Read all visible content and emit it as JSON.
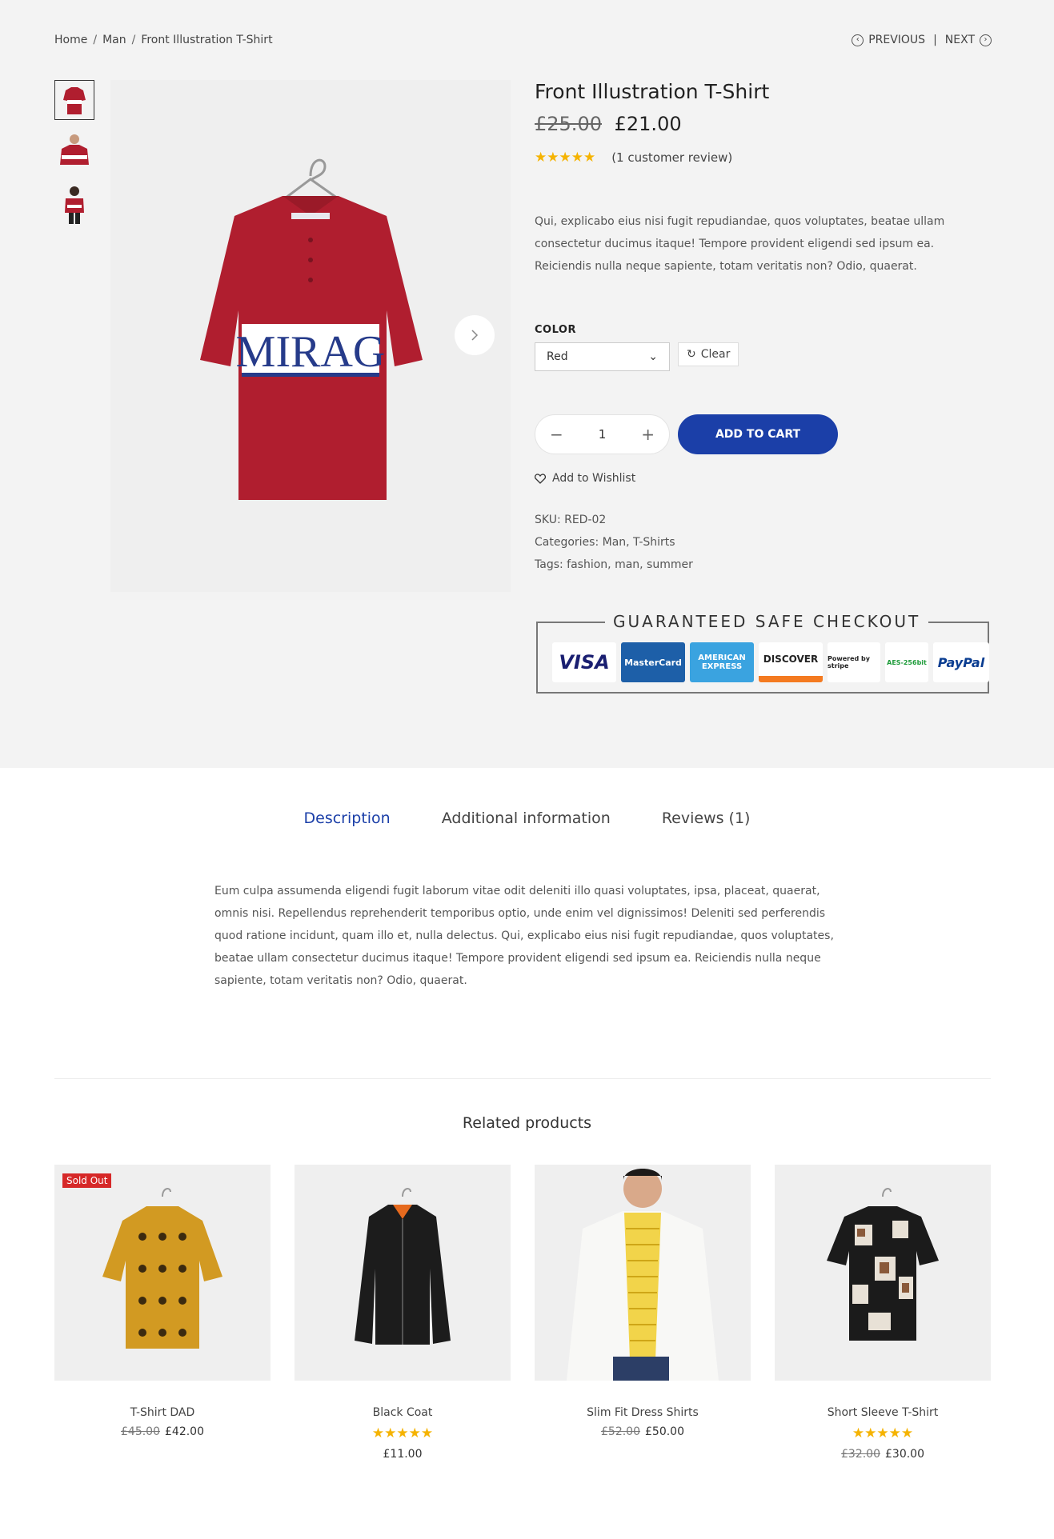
{
  "breadcrumb": [
    "Home",
    "Man",
    "Front Illustration T-Shirt"
  ],
  "nav": {
    "previous": "PREVIOUS",
    "sep": "|",
    "next": "NEXT"
  },
  "product": {
    "title": "Front Illustration T-Shirt",
    "old_price": "£25.00",
    "price": "£21.00",
    "rating_stars": "★★★★★",
    "review_text": "(1 customer review)",
    "short_desc": "Qui, explicabo eius nisi fugit repudiandae, quos voluptates, beatae ullam consectetur ducimus itaque! Tempore provident eligendi sed ipsum ea. Reiciendis nulla neque sapiente, totam veritatis non? Odio, quaerat.",
    "color_label": "COLOR",
    "color_value": "Red",
    "clear_label": "Clear",
    "qty": "1",
    "qty_minus": "−",
    "qty_plus": "+",
    "add_to_cart": "ADD TO CART",
    "wishlist": "Add to Wishlist",
    "sku": "SKU: RED-02",
    "categories": "Categories: Man, T-Shirts",
    "tags": "Tags: fashion, man, summer",
    "image_text": "MIRAG"
  },
  "checkout": {
    "title": "GUARANTEED SAFE CHECKOUT",
    "cards": [
      "VISA",
      "MasterCard",
      "AMERICAN EXPRESS",
      "DISCOVER",
      "Powered by stripe",
      "AES-256bit",
      "PayPal"
    ]
  },
  "tabs": [
    "Description",
    "Additional information",
    "Reviews (1)"
  ],
  "description": "Eum culpa assumenda eligendi fugit laborum vitae odit deleniti illo quasi voluptates, ipsa, placeat, quaerat, omnis nisi. Repellendus reprehenderit temporibus optio, unde enim vel dignissimos! Deleniti sed perferendis quod ratione incidunt, quam illo et, nulla delectus. Qui, explicabo eius nisi fugit repudiandae, quos voluptates, beatae ullam consectetur ducimus itaque! Tempore provident eligendi sed ipsum ea. Reiciendis nulla neque sapiente, totam veritatis non? Odio, quaerat.",
  "related": {
    "title": "Related products",
    "items": [
      {
        "name": "T-Shirt DAD",
        "old": "£45.00",
        "price": "£42.00",
        "badge": "Sold Out",
        "stars": ""
      },
      {
        "name": "Black Coat",
        "old": "",
        "price": "£11.00",
        "badge": "",
        "stars": "★★★★★"
      },
      {
        "name": "Slim Fit Dress Shirts",
        "old": "£52.00",
        "price": "£50.00",
        "badge": "",
        "stars": ""
      },
      {
        "name": "Short Sleeve T-Shirt",
        "old": "£32.00",
        "price": "£30.00",
        "badge": "",
        "stars": "★★★★★"
      }
    ]
  },
  "colors": {
    "accent": "#1b3fa8",
    "star": "#f5b301",
    "shirt_red": "#b01e2f",
    "sold_out": "#d62828"
  }
}
